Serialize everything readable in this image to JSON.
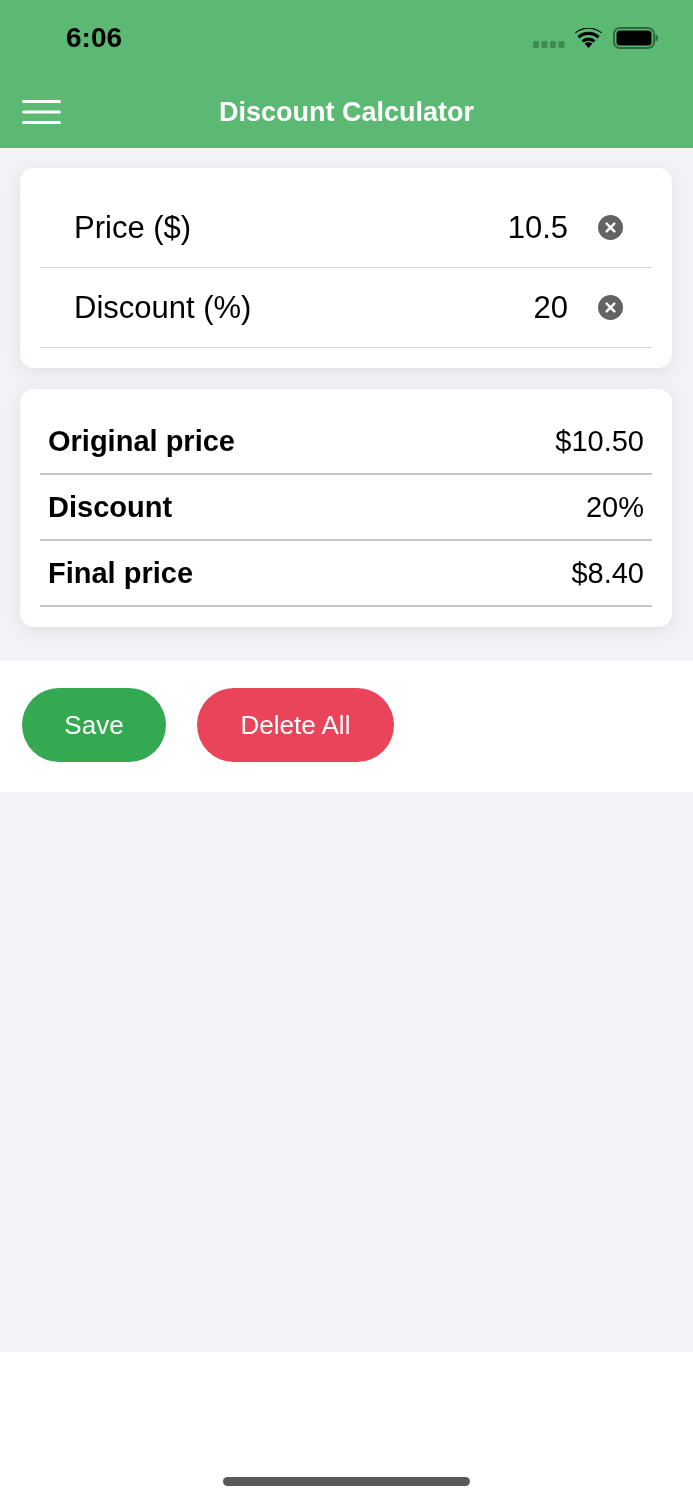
{
  "status_bar": {
    "time": "6:06"
  },
  "nav_bar": {
    "title": "Discount Calculator"
  },
  "inputs": [
    {
      "label": "Price ($)",
      "value": "10.5"
    },
    {
      "label": "Discount (%)",
      "value": "20"
    }
  ],
  "results": [
    {
      "label": "Original price",
      "value": "$10.50"
    },
    {
      "label": "Discount",
      "value": "20%"
    },
    {
      "label": "Final price",
      "value": "$8.40"
    }
  ],
  "buttons": [
    {
      "label": "Save",
      "kind": "save"
    },
    {
      "label": "Delete All",
      "kind": "delete"
    }
  ]
}
